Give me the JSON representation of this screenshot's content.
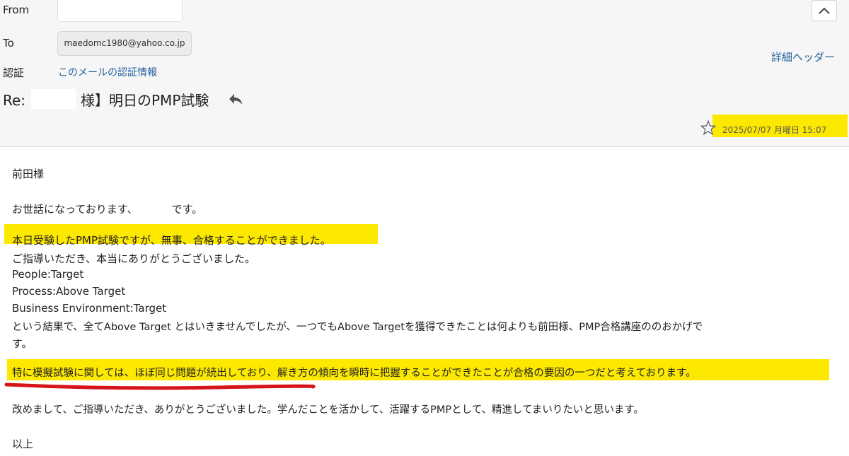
{
  "header": {
    "from_label": "From",
    "to_label": "To",
    "to_address": "maedomc1980@yahoo.co.jp",
    "auth_label": "認証",
    "auth_link": "このメールの認証情報",
    "detail_header_link": "詳細ヘッダー",
    "subject_prefix": "Re:",
    "subject_rest": "様】明日のPMP試験",
    "date": "2025/07/07 月曜日 15:07"
  },
  "body": {
    "greeting": "前田様",
    "intro_before": "お世話になっております、",
    "intro_after": "です。",
    "line_pass": "本日受験したPMP試験ですが、無事、合格することができました。",
    "line_thanks": "ご指導いただき、本当にありがとうございました。",
    "result_people": "People:Target",
    "result_process": "Process:Above Target",
    "result_business": "Business Environment:Target",
    "line_result_1": "という結果で、全てAbove Target とはいきませんでしたが、一つでもAbove Targetを獲得できたことは何よりも前田様、PMP合格講座ののおかげで",
    "line_result_2": "す。",
    "line_mock": "特に模擬試験に関しては、ほぼ同じ問題が続出しており、解き方の傾向を瞬時に把握することができたことが合格の要因の一つだと考えております。",
    "line_closing": "改めまして、ご指導いただき、ありがとうございました。学んだことを活かして、活躍するPMPとして、精進してまいりたいと思います。",
    "sign_off": "以上"
  },
  "colors": {
    "highlight": "#fde800",
    "underline": "#d6151b",
    "link": "#1f5f9e"
  },
  "icons": [
    "chevron-up-icon",
    "reply-arrow-icon",
    "star-icon"
  ]
}
